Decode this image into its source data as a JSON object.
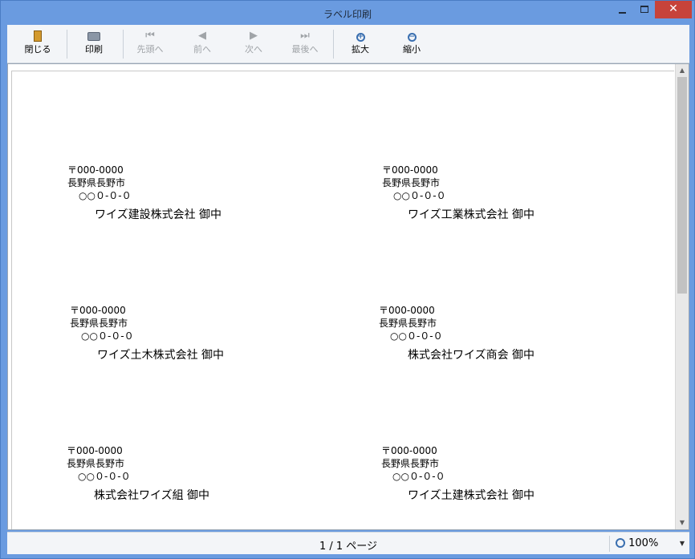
{
  "window": {
    "title": "ラベル印刷",
    "minimize": "—",
    "maximize": "□",
    "close": "✕"
  },
  "toolbar": {
    "buttons": [
      {
        "label": "閉じる",
        "icon": "door-icon",
        "enabled": true
      },
      {
        "label": "印刷",
        "icon": "printer-icon",
        "enabled": true
      },
      {
        "label": "先頭へ",
        "icon": "first-page-icon",
        "enabled": false
      },
      {
        "label": "前へ",
        "icon": "previous-icon",
        "enabled": false
      },
      {
        "label": "次へ",
        "icon": "next-icon",
        "enabled": false
      },
      {
        "label": "最後へ",
        "icon": "last-page-icon",
        "enabled": false
      },
      {
        "label": "拡大",
        "icon": "zoom-in-icon",
        "enabled": true
      },
      {
        "label": "縮小",
        "icon": "zoom-out-icon",
        "enabled": true
      }
    ]
  },
  "labels": [
    {
      "zip": "〒000-0000",
      "addr1": "長野県長野市",
      "addr2": "○○０-０-０",
      "name": "ワイズ建設株式会社 御中"
    },
    {
      "zip": "〒000-0000",
      "addr1": "長野県長野市",
      "addr2": "○○０-０-０",
      "name": "ワイズ工業株式会社 御中"
    },
    {
      "zip": "〒000-0000",
      "addr1": "長野県長野市",
      "addr2": "○○０-０-０",
      "name": "ワイズ土木株式会社  御中"
    },
    {
      "zip": "〒000-0000",
      "addr1": "長野県長野市",
      "addr2": "○○０-０-０",
      "name": "株式会社ワイズ商会 御中"
    },
    {
      "zip": "〒000-0000",
      "addr1": "長野県長野市",
      "addr2": "○○０-０-０",
      "name": "株式会社ワイズ組  御中"
    },
    {
      "zip": "〒000-0000",
      "addr1": "長野県長野市",
      "addr2": "○○０-０-０",
      "name": "ワイズ土建株式会社  御中"
    }
  ],
  "status": {
    "page_info": "1 /  1 ページ",
    "zoom": "100%"
  },
  "colors": {
    "titlebar": "#6a9be0",
    "close_button": "#c7433a",
    "toolbar": "#f3f5f8"
  }
}
